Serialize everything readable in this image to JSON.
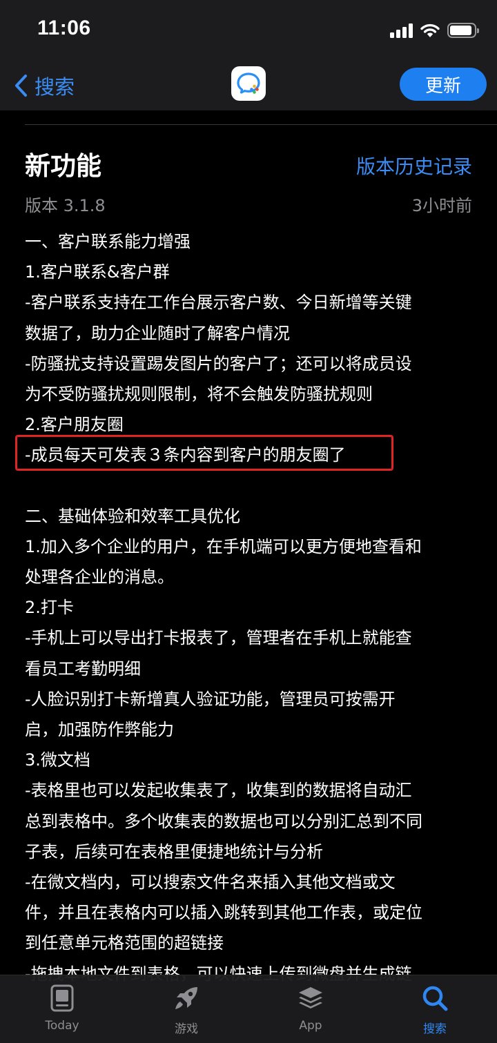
{
  "status_bar": {
    "time": "11:06",
    "battery_level": 0.9
  },
  "nav": {
    "back_label": "搜索",
    "update_label": "更新"
  },
  "whats_new": {
    "title": "新功能",
    "history_link": "版本历史记录",
    "version": "版本 3.1.8",
    "time_ago": "3小时前",
    "lines": [
      "一、客户联系能力增强",
      "1.客户联系&客户群",
      "-客户联系支持在工作台展示客户数、今日新增等关键",
      "数据了，助力企业随时了解客户情况",
      "-防骚扰支持设置踢发图片的客户了；还可以将成员设",
      "为不受防骚扰规则限制，将不会触发防骚扰规则",
      "2.客户朋友圈",
      "-成员每天可发表３条内容到客户的朋友圈了",
      "",
      "二、基础体验和效率工具优化",
      "1.加入多个企业的用户，在手机端可以更方便地查看和",
      "处理各企业的消息。",
      "2.打卡",
      "-手机上可以导出打卡报表了，管理者在手机上就能查",
      "看员工考勤明细",
      "-人脸识别打卡新增真人验证功能，管理员可按需开",
      "启，加强防作弊能力",
      "3.微文档",
      "-表格里也可以发起收集表了，收集到的数据将自动汇",
      "总到表格中。多个收集表的数据也可以分别汇总到不同",
      "子表，后续可在表格里便捷地统计与分析",
      "-在微文档内，可以搜索文件名来插入其他文档或文",
      "件，并且在表格内可以插入跳转到其他工作表，或定位",
      "到任意单元格范围的超链接",
      "-拖拽本地文件到表格，可以快速上传到微盘并生成链"
    ]
  },
  "tab_bar": {
    "tabs": [
      {
        "label": "Today",
        "icon": "today-icon",
        "active": false
      },
      {
        "label": "游戏",
        "icon": "rocket-icon",
        "active": false
      },
      {
        "label": "App",
        "icon": "layers-icon",
        "active": false
      },
      {
        "label": "搜索",
        "icon": "search-icon",
        "active": true
      }
    ]
  },
  "colors": {
    "accent": "#3a8df5",
    "update_button": "#1e7ff0",
    "highlight": "#e02424",
    "secondary_text": "#8e8e93"
  }
}
